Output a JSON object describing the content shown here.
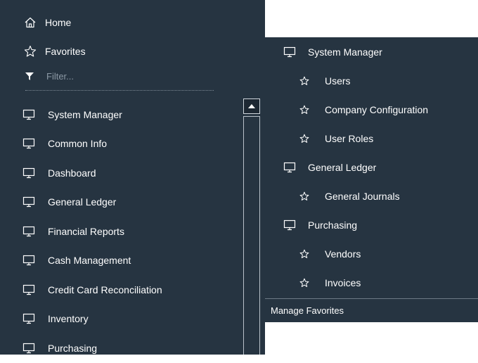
{
  "colors": {
    "panel_bg": "#263441",
    "text": "#ffffff",
    "muted_text": "#8b98a4",
    "divider": "#7d8a96",
    "scrollbar_border": "#cfd6dc"
  },
  "nav": {
    "home": {
      "label": "Home",
      "icon": "home-icon"
    },
    "favorites": {
      "label": "Favorites",
      "icon": "star-outline-icon"
    },
    "filter": {
      "placeholder": "Filter...",
      "icon": "filter-funnel-icon"
    }
  },
  "modules": [
    {
      "label": "System Manager",
      "icon": "monitor-icon"
    },
    {
      "label": "Common Info",
      "icon": "monitor-icon"
    },
    {
      "label": "Dashboard",
      "icon": "monitor-icon"
    },
    {
      "label": "General Ledger",
      "icon": "monitor-icon"
    },
    {
      "label": "Financial Reports",
      "icon": "monitor-icon"
    },
    {
      "label": "Cash Management",
      "icon": "monitor-icon"
    },
    {
      "label": "Credit Card Reconciliation",
      "icon": "monitor-icon"
    },
    {
      "label": "Inventory",
      "icon": "monitor-icon"
    },
    {
      "label": "Purchasing",
      "icon": "monitor-icon"
    }
  ],
  "favorites_flyout": {
    "items": [
      {
        "label": "System Manager",
        "kind": "group",
        "icon": "monitor-icon"
      },
      {
        "label": "Users",
        "kind": "child",
        "icon": "star-icon"
      },
      {
        "label": "Company Configuration",
        "kind": "child",
        "icon": "star-icon"
      },
      {
        "label": "User Roles",
        "kind": "child",
        "icon": "star-icon"
      },
      {
        "label": "General Ledger",
        "kind": "group",
        "icon": "monitor-icon"
      },
      {
        "label": "General Journals",
        "kind": "child",
        "icon": "star-icon"
      },
      {
        "label": "Purchasing",
        "kind": "group",
        "icon": "monitor-icon"
      },
      {
        "label": "Vendors",
        "kind": "child",
        "icon": "star-icon"
      },
      {
        "label": "Invoices",
        "kind": "child",
        "icon": "star-icon"
      }
    ],
    "manage_label": "Manage Favorites"
  }
}
